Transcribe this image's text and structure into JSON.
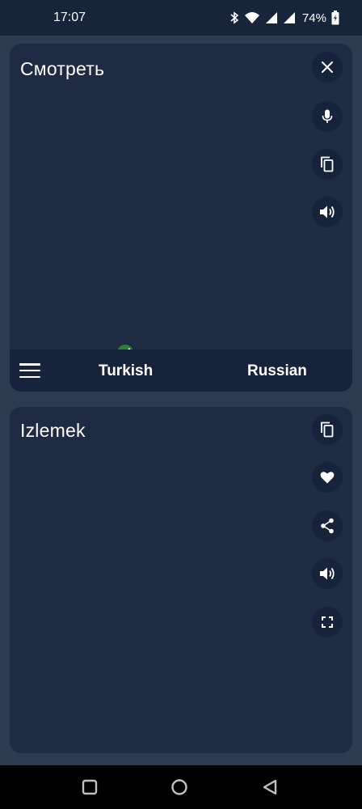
{
  "status": {
    "time": "17:07",
    "battery_percent": "74%"
  },
  "source_card": {
    "text": "Смотреть",
    "actions": [
      "close-icon",
      "microphone-icon",
      "copy-icon",
      "volume-icon"
    ]
  },
  "language_bar": {
    "source_language": "Turkish",
    "target_language": "Russian"
  },
  "result_card": {
    "text": "Izlemek",
    "actions": [
      "copy-icon",
      "heart-icon",
      "share-icon",
      "volume-icon",
      "fullscreen-icon"
    ]
  },
  "nav": {
    "buttons": [
      "recents-square-icon",
      "home-circle-icon",
      "back-triangle-icon"
    ]
  },
  "colors": {
    "background": "#2d3a50",
    "card": "#1f2b42",
    "button": "#17233a",
    "check": "#2e7d32"
  }
}
